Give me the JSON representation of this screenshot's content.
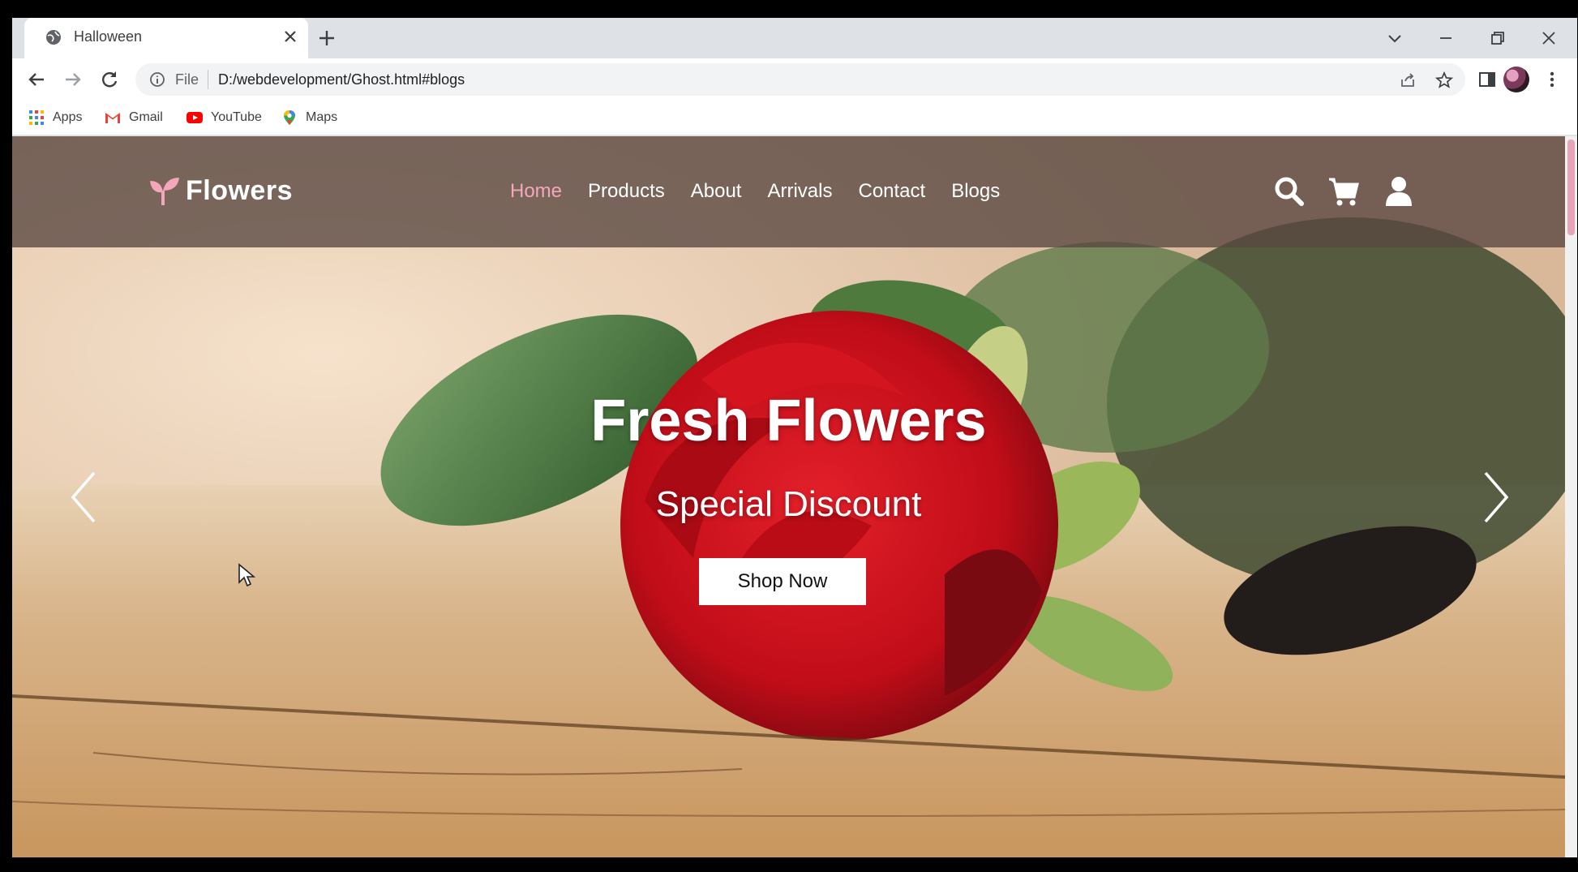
{
  "browser": {
    "tab": {
      "title": "Halloween"
    },
    "address": {
      "scheme": "File",
      "url": "D:/webdevelopment/Ghost.html#blogs"
    },
    "bookmarks": [
      {
        "label": "Apps",
        "icon": "apps-grid-icon"
      },
      {
        "label": "Gmail",
        "icon": "gmail-icon"
      },
      {
        "label": "YouTube",
        "icon": "youtube-icon"
      },
      {
        "label": "Maps",
        "icon": "maps-icon"
      }
    ]
  },
  "site": {
    "logo": "Flowers",
    "nav": [
      "Home",
      "Products",
      "About",
      "Arrivals",
      "Contact",
      "Blogs"
    ],
    "active_nav": "Home",
    "hero": {
      "title": "Fresh Flowers",
      "subtitle": "Special Discount",
      "cta": "Shop Now"
    }
  },
  "colors": {
    "accent_pink": "#f4a7bb",
    "header_overlay": "#584640",
    "rose_red": "#c8101a"
  }
}
